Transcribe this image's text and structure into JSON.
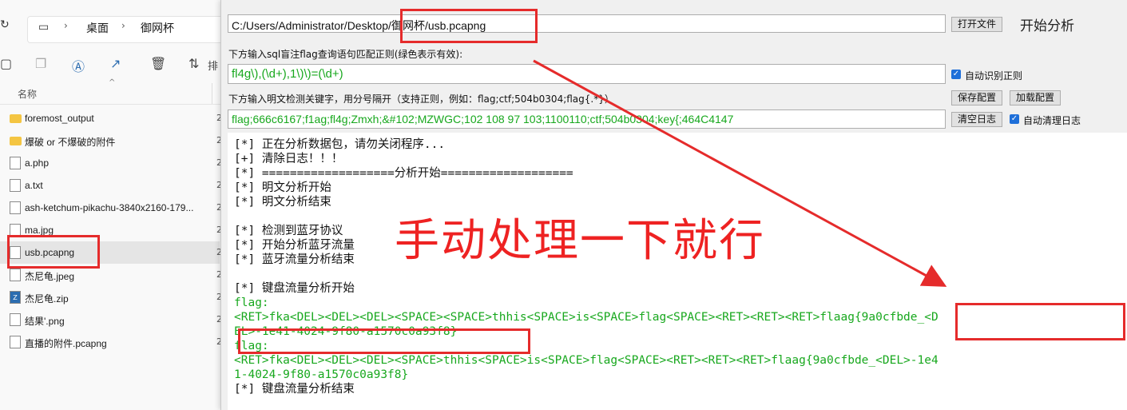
{
  "explorer": {
    "address": {
      "crumbs": [
        "桌面",
        "御网杯"
      ]
    },
    "toolbar_icons": [
      "folder-icon",
      "copy-icon",
      "rename-icon",
      "share-icon",
      "delete-icon",
      "sort-icon"
    ],
    "sort_label": "排",
    "column_header": "名称",
    "files": [
      {
        "name": "foremost_output",
        "icon": "folder-icon"
      },
      {
        "name": "爆破 or 不爆破的附件",
        "icon": "folder-icon"
      },
      {
        "name": "a.php",
        "icon": "php-file-icon"
      },
      {
        "name": "a.txt",
        "icon": "text-file-icon"
      },
      {
        "name": "ash-ketchum-pikachu-3840x2160-179...",
        "icon": "image-file-icon"
      },
      {
        "name": "ma.jpg",
        "icon": "image-file-icon"
      },
      {
        "name": "usb.pcapng",
        "icon": "pcap-file-icon",
        "selected": true
      },
      {
        "name": "杰尼龟.jpeg",
        "icon": "image-file-icon"
      },
      {
        "name": "杰尼龟.zip",
        "icon": "zip-file-icon"
      },
      {
        "name": "结果'.png",
        "icon": "image-file-icon"
      },
      {
        "name": "直播的附件.pcapng",
        "icon": "pcap-file-icon"
      }
    ],
    "date_prefix": "2"
  },
  "analyzer": {
    "file_path": "C:/Users/Administrator/Desktop/御网杯/usb.pcapng",
    "open_file_button": "打开文件",
    "start_analysis_button": "开始分析",
    "regex_label": "下方输入sql盲注flag查询语句匹配正则(绿色表示有效):",
    "regex_value": "fl4g\\),(\\d+),1\\)\\)=(\\d+)",
    "auto_regex_label": "自动识别正则",
    "keyword_label": "下方输入明文检测关键字，用分号隔开（支持正则，例如：flag;ctf;504b0304;flag{.*}）",
    "save_config_button": "保存配置",
    "load_config_button": "加载配置",
    "keyword_value": "flag;666c6167;f1ag;fl4g;Zmxh;&#102;MZWGC;102 108 97 103;1100110;ctf;504b0304;key{;464C4147",
    "clear_log_button": "清空日志",
    "auto_clear_label": "自动清理日志",
    "log": [
      {
        "text": "[*] 正在分析数据包，请勿关闭程序...",
        "green": false
      },
      {
        "text": "[+] 清除日志！！！",
        "green": false
      },
      {
        "text": "[*] ===================分析开始===================",
        "green": false
      },
      {
        "text": "[*] 明文分析开始",
        "green": false
      },
      {
        "text": "[*] 明文分析结束",
        "green": false
      },
      {
        "text": "",
        "green": false
      },
      {
        "text": "[*] 检测到蓝牙协议",
        "green": false
      },
      {
        "text": "[*] 开始分析蓝牙流量",
        "green": false
      },
      {
        "text": "[*] 蓝牙流量分析结束",
        "green": false
      },
      {
        "text": "",
        "green": false
      },
      {
        "text": "[*] 键盘流量分析开始",
        "green": false
      },
      {
        "text": "flag:",
        "green": true
      },
      {
        "text": "<RET>fka<DEL><DEL><DEL><SPACE><SPACE>thhis<SPACE>is<SPACE>flag<SPACE><RET><RET><RET>flaag{9a0cfbde_<D",
        "green": true
      },
      {
        "text": "EL>-1e41-4024-9f80-a1570c0a93f8}",
        "green": true
      },
      {
        "text": "flag:",
        "green": true
      },
      {
        "text": "<RET>fka<DEL><DEL><DEL><SPACE>thhis<SPACE>is<SPACE>flag<SPACE><RET><RET><RET>flaag{9a0cfbde_<DEL>-1e4",
        "green": true
      },
      {
        "text": "1-4024-9f80-a1570c0a93f8}",
        "green": true
      },
      {
        "text": "[*] 键盘流量分析结束",
        "green": false
      }
    ]
  },
  "annotation": {
    "text": "手动处理一下就行",
    "color": "#e52b2b"
  },
  "colors": {
    "log_green": "#18a81e",
    "checkbox_blue": "#1e6fd9"
  }
}
